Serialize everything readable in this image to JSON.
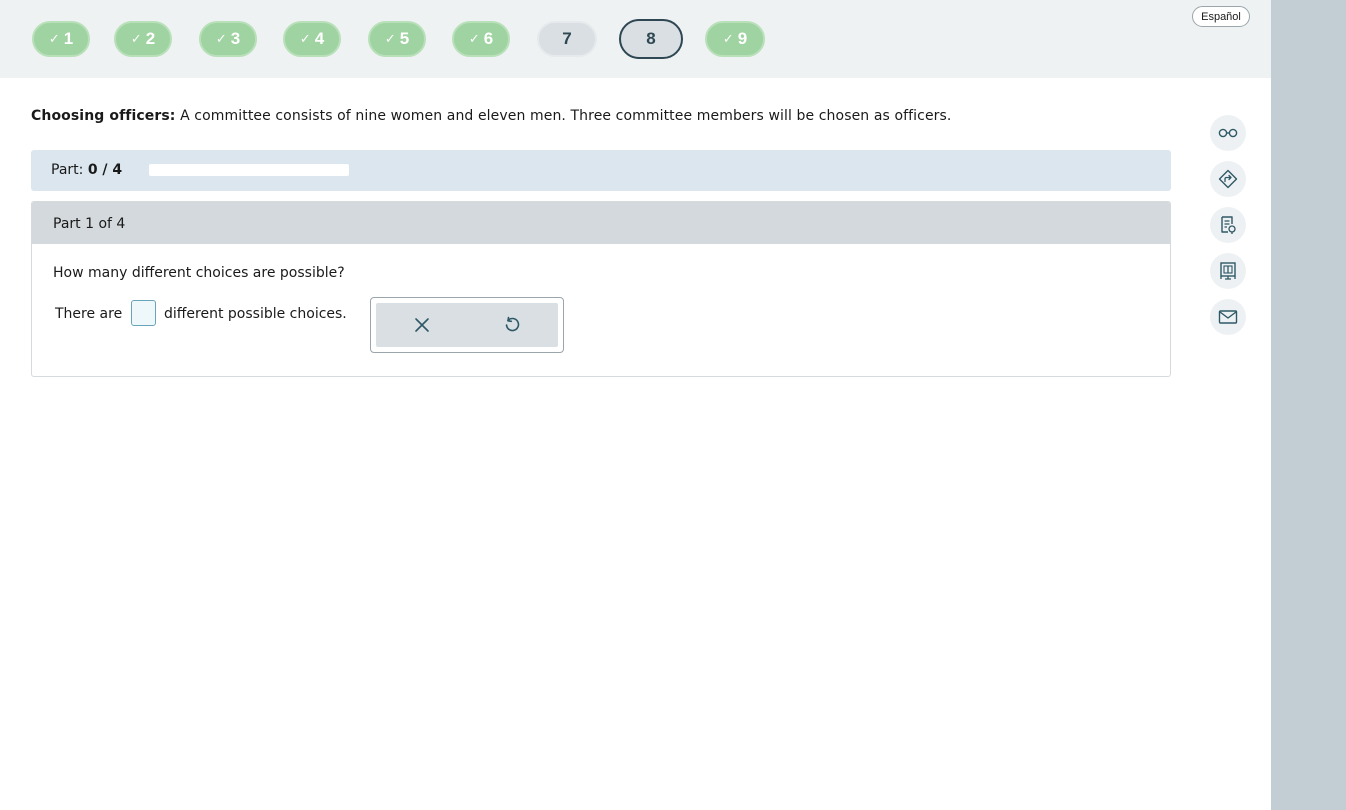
{
  "nav": {
    "questions": [
      {
        "label": "1",
        "status": "done"
      },
      {
        "label": "2",
        "status": "done"
      },
      {
        "label": "3",
        "status": "done"
      },
      {
        "label": "4",
        "status": "done"
      },
      {
        "label": "5",
        "status": "done"
      },
      {
        "label": "6",
        "status": "done"
      },
      {
        "label": "7",
        "status": "todo"
      },
      {
        "label": "8",
        "status": "current"
      },
      {
        "label": "9",
        "status": "done"
      }
    ],
    "check_glyph": "✓",
    "language_button": "Español"
  },
  "problem": {
    "title": "Choosing officers:",
    "text": "A committee consists of nine women and eleven men. Three committee members will be chosen as officers."
  },
  "progress": {
    "label": "Part:",
    "value_text": "0 / 4",
    "fraction": 0
  },
  "part": {
    "title": "Part 1 of 4",
    "question": "How many different choices are possible?",
    "answer_prefix": "There are",
    "answer_value": "",
    "answer_suffix": "different possible choices."
  },
  "answer_tools": {
    "clear_icon": "close-icon",
    "reset_icon": "undo-icon"
  },
  "side_tools": [
    {
      "icon": "glasses-icon"
    },
    {
      "icon": "directions-icon"
    },
    {
      "icon": "checklist-icon"
    },
    {
      "icon": "whiteboard-icon"
    },
    {
      "icon": "mail-icon"
    }
  ],
  "colors": {
    "done": "#9fd3a1",
    "todo": "#d9dfe2",
    "current_border": "#2e4753",
    "progress_bg": "#dce6ee",
    "part_header": "#d3d9dc",
    "gutter": "#c2cdd4",
    "icon": "#2e5866"
  }
}
